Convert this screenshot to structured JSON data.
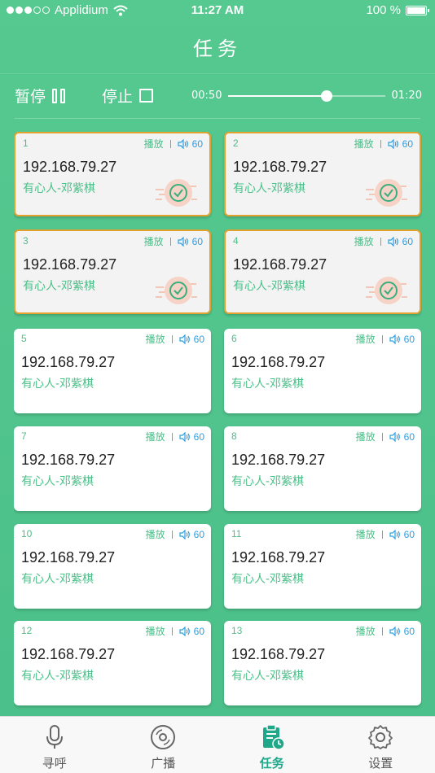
{
  "status_bar": {
    "carrier": "Applidium",
    "time": "11:27 AM",
    "battery": "100 %"
  },
  "nav": {
    "title": "任务"
  },
  "controls": {
    "pause_label": "暂停",
    "stop_label": "停止",
    "time_current": "00:50",
    "time_total": "01:20",
    "progress_fraction": 0.625
  },
  "tasks": [
    {
      "number": "1",
      "status": "播放",
      "volume": "60",
      "ip": "192.168.79.27",
      "name": "有心人-邓紫棋",
      "done": true
    },
    {
      "number": "2",
      "status": "播放",
      "volume": "60",
      "ip": "192.168.79.27",
      "name": "有心人-邓紫棋",
      "done": true
    },
    {
      "number": "3",
      "status": "播放",
      "volume": "60",
      "ip": "192.168.79.27",
      "name": "有心人-邓紫棋",
      "done": true
    },
    {
      "number": "4",
      "status": "播放",
      "volume": "60",
      "ip": "192.168.79.27",
      "name": "有心人-邓紫棋",
      "done": true
    },
    {
      "number": "5",
      "status": "播放",
      "volume": "60",
      "ip": "192.168.79.27",
      "name": "有心人-邓紫棋",
      "done": false
    },
    {
      "number": "6",
      "status": "播放",
      "volume": "60",
      "ip": "192.168.79.27",
      "name": "有心人-邓紫棋",
      "done": false
    },
    {
      "number": "7",
      "status": "播放",
      "volume": "60",
      "ip": "192.168.79.27",
      "name": "有心人-邓紫棋",
      "done": false
    },
    {
      "number": "8",
      "status": "播放",
      "volume": "60",
      "ip": "192.168.79.27",
      "name": "有心人-邓紫棋",
      "done": false
    },
    {
      "number": "10",
      "status": "播放",
      "volume": "60",
      "ip": "192.168.79.27",
      "name": "有心人-邓紫棋",
      "done": false
    },
    {
      "number": "11",
      "status": "播放",
      "volume": "60",
      "ip": "192.168.79.27",
      "name": "有心人-邓紫棋",
      "done": false
    },
    {
      "number": "12",
      "status": "播放",
      "volume": "60",
      "ip": "192.168.79.27",
      "name": "有心人-邓紫棋",
      "done": false
    },
    {
      "number": "13",
      "status": "播放",
      "volume": "60",
      "ip": "192.168.79.27",
      "name": "有心人-邓紫棋",
      "done": false
    }
  ],
  "tab_bar": {
    "tabs": [
      {
        "label": "寻呼",
        "icon": "microphone-icon",
        "active": false
      },
      {
        "label": "广播",
        "icon": "disc-icon",
        "active": false
      },
      {
        "label": "任务",
        "icon": "task-list-icon",
        "active": true
      },
      {
        "label": "设置",
        "icon": "gear-icon",
        "active": false
      }
    ]
  },
  "colors": {
    "primary_green": "#4bbf89",
    "active_tab": "#1ea889",
    "volume_blue": "#2a9fe0",
    "done_border": "#e3a12d"
  }
}
